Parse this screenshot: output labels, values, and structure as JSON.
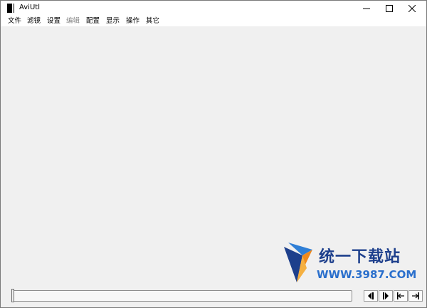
{
  "window": {
    "title": "AviUtl",
    "controls": {
      "minimize_icon": "minimize-icon",
      "maximize_icon": "maximize-icon",
      "close_icon": "close-icon"
    }
  },
  "menubar": {
    "items": [
      {
        "label": "文件",
        "enabled": true
      },
      {
        "label": "滤镜",
        "enabled": true
      },
      {
        "label": "设置",
        "enabled": true
      },
      {
        "label": "编辑",
        "enabled": false
      },
      {
        "label": "配置",
        "enabled": true
      },
      {
        "label": "显示",
        "enabled": true
      },
      {
        "label": "操作",
        "enabled": true
      },
      {
        "label": "其它",
        "enabled": true
      }
    ]
  },
  "timeline": {
    "position": 0
  },
  "navigation": {
    "buttons": [
      {
        "icon": "step-back-icon"
      },
      {
        "icon": "step-forward-icon"
      },
      {
        "icon": "go-to-start-icon"
      },
      {
        "icon": "go-to-end-icon"
      }
    ]
  },
  "watermark": {
    "title": "统一下载站",
    "url": "WWW.3987.COM",
    "colors": {
      "blue": "#1d3f8c",
      "orange": "#f08a1c",
      "light_blue": "#2a6fcc"
    }
  }
}
